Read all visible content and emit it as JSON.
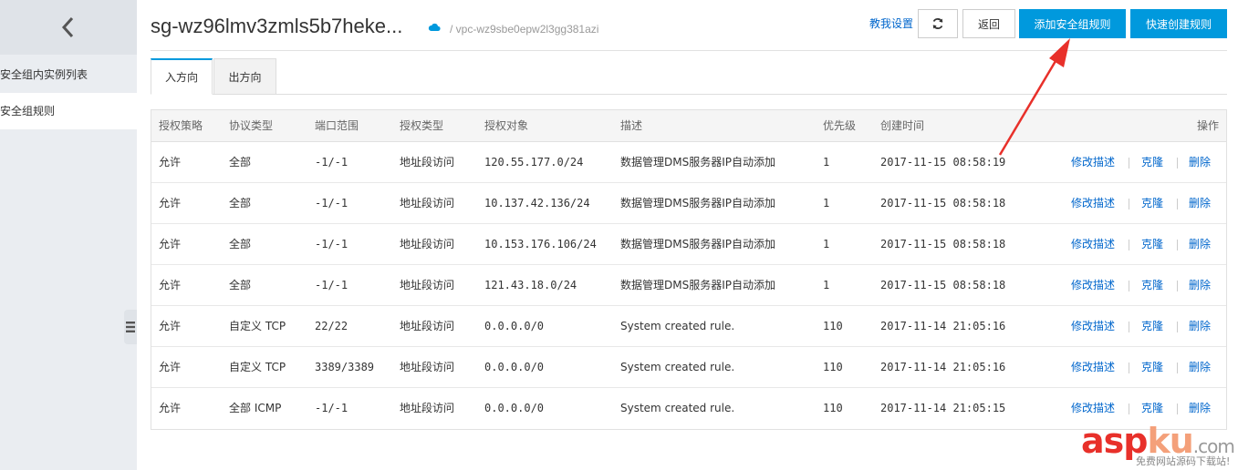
{
  "sidebar": {
    "items": [
      {
        "label": "安全组内实例列表",
        "active": false
      },
      {
        "label": "安全组规则",
        "active": true
      }
    ]
  },
  "header": {
    "title": "sg-wz96lmv3zmls5b7heke...",
    "subpath": "/ vpc-wz9sbe0epw2l3gg381azi",
    "help_link": "教我设置",
    "back_button": "返回",
    "add_rule_button": "添加安全组规则",
    "quick_rule_button": "快速创建规则"
  },
  "tabs": [
    {
      "label": "入方向",
      "active": true
    },
    {
      "label": "出方向",
      "active": false
    }
  ],
  "table": {
    "columns": [
      "授权策略",
      "协议类型",
      "端口范围",
      "授权类型",
      "授权对象",
      "描述",
      "优先级",
      "创建时间",
      "操作"
    ],
    "actions": [
      "修改描述",
      "克隆",
      "删除"
    ],
    "rows": [
      {
        "policy": "允许",
        "protocol": "全部",
        "port": "-1/-1",
        "auth_type": "地址段访问",
        "object": "120.55.177.0/24",
        "desc": "数据管理DMS服务器IP自动添加",
        "priority": "1",
        "time": "2017-11-15 08:58:19"
      },
      {
        "policy": "允许",
        "protocol": "全部",
        "port": "-1/-1",
        "auth_type": "地址段访问",
        "object": "10.137.42.136/24",
        "desc": "数据管理DMS服务器IP自动添加",
        "priority": "1",
        "time": "2017-11-15 08:58:18"
      },
      {
        "policy": "允许",
        "protocol": "全部",
        "port": "-1/-1",
        "auth_type": "地址段访问",
        "object": "10.153.176.106/24",
        "desc": "数据管理DMS服务器IP自动添加",
        "priority": "1",
        "time": "2017-11-15 08:58:18"
      },
      {
        "policy": "允许",
        "protocol": "全部",
        "port": "-1/-1",
        "auth_type": "地址段访问",
        "object": "121.43.18.0/24",
        "desc": "数据管理DMS服务器IP自动添加",
        "priority": "1",
        "time": "2017-11-15 08:58:18"
      },
      {
        "policy": "允许",
        "protocol": "自定义 TCP",
        "port": "22/22",
        "auth_type": "地址段访问",
        "object": "0.0.0.0/0",
        "desc": "System created rule.",
        "priority": "110",
        "time": "2017-11-14 21:05:16"
      },
      {
        "policy": "允许",
        "protocol": "自定义 TCP",
        "port": "3389/3389",
        "auth_type": "地址段访问",
        "object": "0.0.0.0/0",
        "desc": "System created rule.",
        "priority": "110",
        "time": "2017-11-14 21:05:16"
      },
      {
        "policy": "允许",
        "protocol": "全部 ICMP",
        "port": "-1/-1",
        "auth_type": "地址段访问",
        "object": "0.0.0.0/0",
        "desc": "System created rule.",
        "priority": "110",
        "time": "2017-11-14 21:05:15"
      }
    ]
  },
  "watermark": {
    "text_a": "asp",
    "text_b": "ku",
    "text_c": ".com",
    "sub": "免费网站源码下载站!"
  },
  "colors": {
    "accent": "#0099dd",
    "link": "#0066cc",
    "annotation": "#e8302a"
  }
}
